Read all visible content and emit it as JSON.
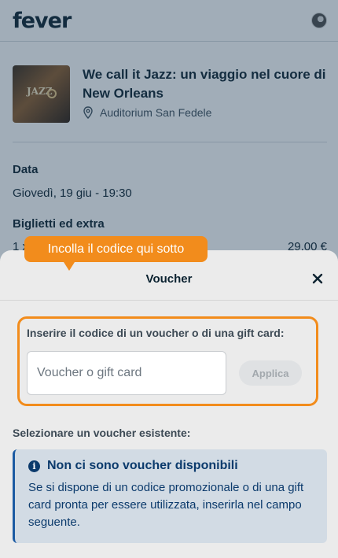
{
  "app": {
    "logo_text": "fever"
  },
  "event": {
    "title": "We call it Jazz: un viaggio nel cuore di New Orleans",
    "venue": "Auditorium San Fedele",
    "thumbnail_text": "JAZZ"
  },
  "details": {
    "date_label": "Data",
    "date_value": "Giovedì, 19 giu - 19:30",
    "tickets_label": "Biglietti ed extra",
    "ticket_qty": "1 x",
    "ticket_price": "29,00 €"
  },
  "tooltip": {
    "text": "Incolla il codice qui sotto"
  },
  "sheet": {
    "title": "Voucher",
    "voucher_label": "Inserire il codice di un voucher o di una gift card:",
    "input_placeholder": "Voucher o gift card",
    "input_value": "",
    "apply_label": "Applica",
    "existing_label": "Selezionare un voucher esistente:",
    "info_title": "Non ci sono voucher disponibili",
    "info_text": "Se si dispone di un codice promozionale o di una gift card pronta per essere utilizzata, inserirla nel campo seguente.",
    "info_icon": "i"
  },
  "colors": {
    "accent": "#f28c1c",
    "info_blue": "#0b3a6c",
    "info_bg": "#d2dbe4"
  },
  "icons": [
    "location-pin-icon",
    "close-icon",
    "info-icon",
    "avatar"
  ]
}
